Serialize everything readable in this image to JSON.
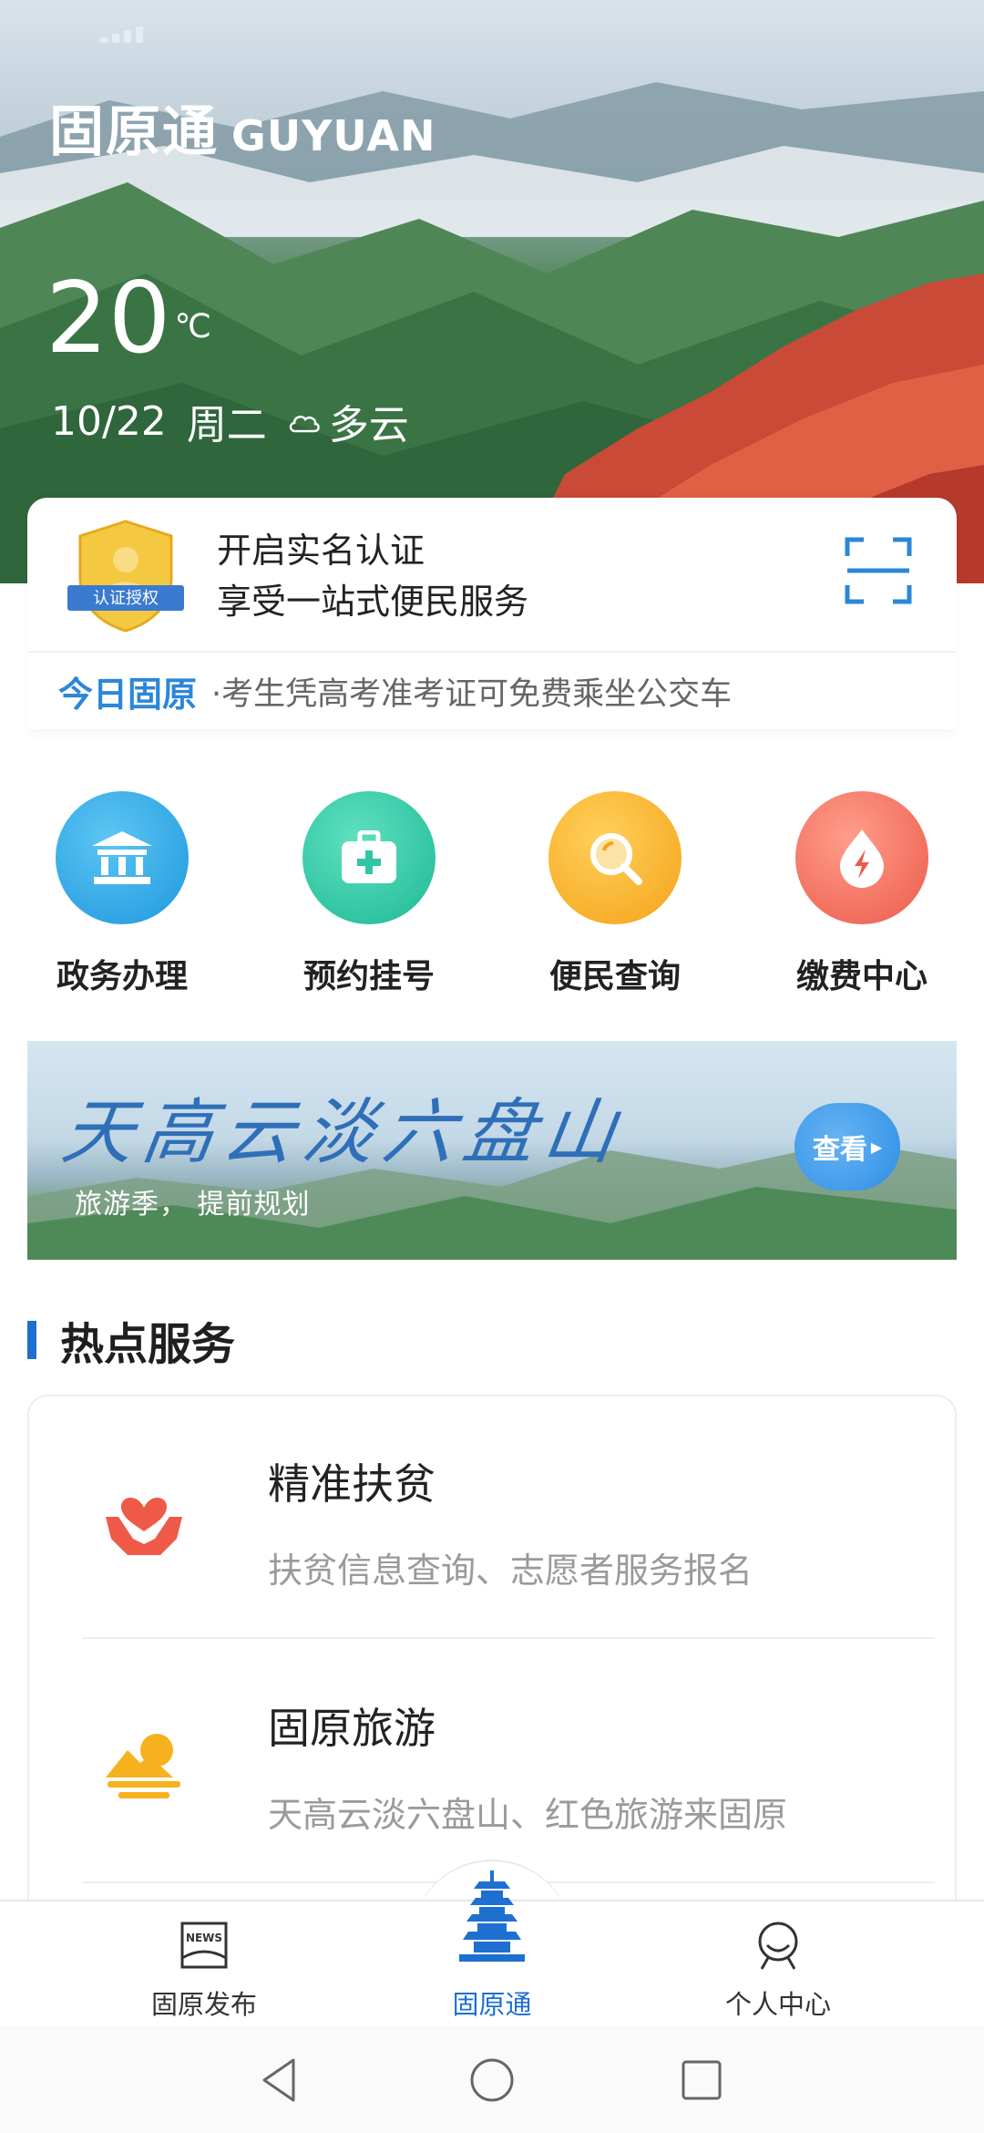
{
  "hero": {
    "brand_cn": "固原通",
    "brand_en": "GUYUAN",
    "temperature": "20",
    "temperature_unit": "℃",
    "date": "10/22",
    "weekday": "周二",
    "weather": "多云"
  },
  "auth_card": {
    "badge_text": "认证授权",
    "line1": "开启实名认证",
    "line2": "享受一站式便民服务"
  },
  "news_strip": {
    "tag": "今日固原",
    "message": "·考生凭高考准考证可免费乘坐公交车"
  },
  "services": [
    {
      "label": "政务办理",
      "icon": "government-building-icon",
      "color": "#2ca6e6"
    },
    {
      "label": "预约挂号",
      "icon": "medical-kit-icon",
      "color": "#2fc6a6"
    },
    {
      "label": "便民查询",
      "icon": "search-icon",
      "color": "#f7ae2e"
    },
    {
      "label": "缴费中心",
      "icon": "payment-lightning-icon",
      "color": "#f16a5c"
    }
  ],
  "banner": {
    "calligraphy": "天高云淡六盘山",
    "subtitle": "旅游季，  提前规划",
    "button": "查看"
  },
  "hot_services": {
    "title": "热点服务",
    "items": [
      {
        "title": "精准扶贫",
        "desc": "扶贫信息查询、志愿者服务报名",
        "icon": "heart-hands-icon"
      },
      {
        "title": "固原旅游",
        "desc": "天高云淡六盘山、红色旅游来固原",
        "icon": "sun-mountain-icon"
      }
    ]
  },
  "tabbar": {
    "tabs": [
      {
        "label": "固原发布",
        "icon": "news-icon"
      },
      {
        "label": "固原通",
        "icon": "pagoda-icon"
      },
      {
        "label": "个人中心",
        "icon": "profile-icon"
      }
    ],
    "active_index": 1,
    "accent_color": "#1e6fd0"
  }
}
